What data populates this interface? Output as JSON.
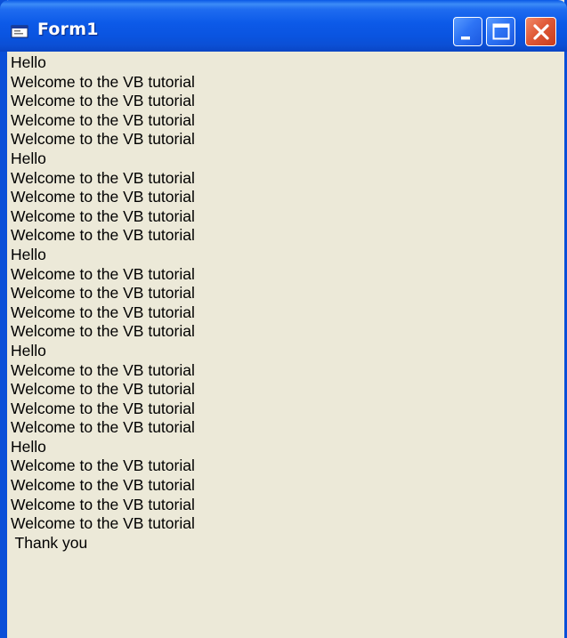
{
  "window": {
    "title": "Form1",
    "title_icon": "form-window-icon",
    "controls": {
      "minimize_icon": "minimize-icon",
      "maximize_icon": "maximize-icon",
      "close_icon": "close-icon"
    },
    "colors": {
      "titlebar": "#0a58e6",
      "client_background": "#ece9d8",
      "close_button": "#e05a38"
    }
  },
  "output_lines": [
    "Hello",
    "Welcome to the VB tutorial",
    "Welcome to the VB tutorial",
    "Welcome to the VB tutorial",
    "Welcome to the VB tutorial",
    "Hello",
    "Welcome to the VB tutorial",
    "Welcome to the VB tutorial",
    "Welcome to the VB tutorial",
    "Welcome to the VB tutorial",
    "Hello",
    "Welcome to the VB tutorial",
    "Welcome to the VB tutorial",
    "Welcome to the VB tutorial",
    "Welcome to the VB tutorial",
    "Hello",
    "Welcome to the VB tutorial",
    "Welcome to the VB tutorial",
    "Welcome to the VB tutorial",
    "Welcome to the VB tutorial",
    "Hello",
    "Welcome to the VB tutorial",
    "Welcome to the VB tutorial",
    "Welcome to the VB tutorial",
    "Welcome to the VB tutorial",
    " Thank you"
  ]
}
